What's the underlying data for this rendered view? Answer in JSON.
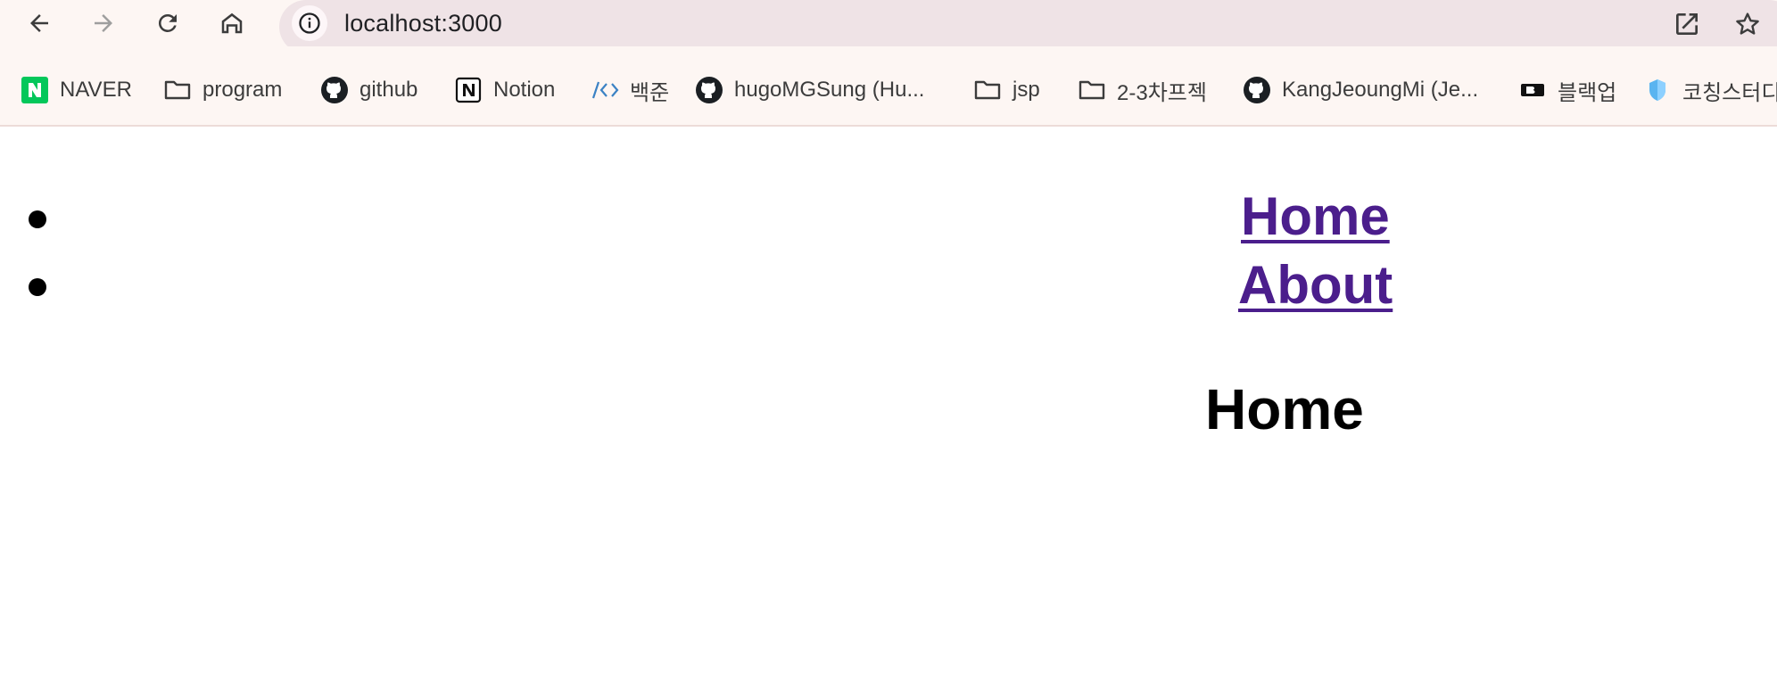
{
  "browser": {
    "url": "localhost:3000",
    "nav": {
      "back_icon": "arrow-left-icon",
      "forward_icon": "arrow-right-icon",
      "reload_icon": "reload-icon",
      "home_icon": "home-icon"
    },
    "omnibox_icons": [
      "site-info-icon",
      "open-in-new-icon",
      "star-icon"
    ]
  },
  "bookmarks": [
    {
      "label": "NAVER",
      "icon": "naver-icon"
    },
    {
      "label": "program",
      "icon": "folder-icon"
    },
    {
      "label": "github",
      "icon": "github-icon"
    },
    {
      "label": "Notion",
      "icon": "notion-icon"
    },
    {
      "label": "백준",
      "icon": "code-icon"
    },
    {
      "label": "hugoMGSung (Hu...",
      "icon": "github-icon"
    },
    {
      "label": "jsp",
      "icon": "folder-icon"
    },
    {
      "label": "2-3차프젝",
      "icon": "folder-icon"
    },
    {
      "label": "KangJeoungMi (Je...",
      "icon": "github-icon"
    },
    {
      "label": "블랙업",
      "icon": "blackup-icon"
    },
    {
      "label": "코칭스터디",
      "icon": "shield-icon"
    }
  ],
  "page": {
    "nav_links": [
      {
        "label": "Home"
      },
      {
        "label": "About"
      }
    ],
    "heading": "Home"
  },
  "colors": {
    "toolbar_bg": "#fdf6f3",
    "omnibox_bg": "#efe3e6",
    "link_visited": "#4b1e8c",
    "naver_green": "#03c75a"
  }
}
